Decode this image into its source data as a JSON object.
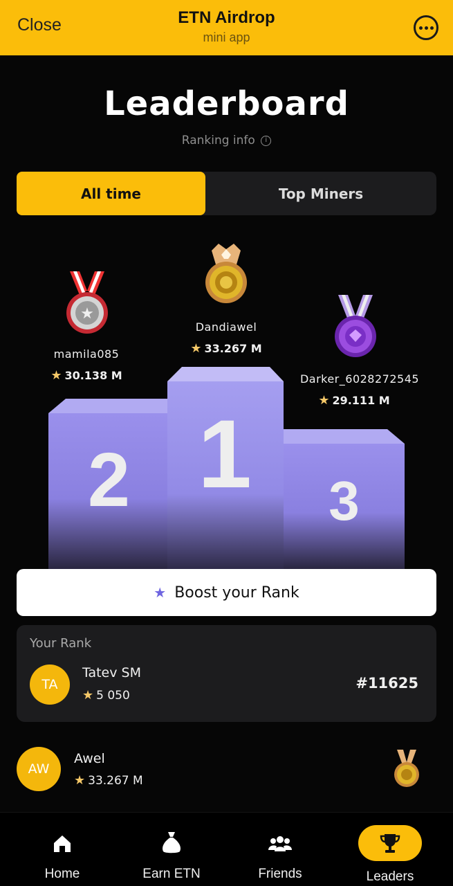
{
  "topbar": {
    "close_label": "Close",
    "title": "ETN Airdrop",
    "subtitle": "mini app",
    "more_icon": "more-horizontal-icon"
  },
  "page": {
    "title": "Leaderboard",
    "ranking_info": "Ranking info",
    "info_icon_glyph": "i"
  },
  "tabs": [
    {
      "label": "All time",
      "active": true
    },
    {
      "label": "Top Miners",
      "active": false
    }
  ],
  "podium": [
    {
      "place": "2",
      "name": "mamila085",
      "score": "30.138 M",
      "medal": "silver-medal-icon",
      "color": "#c9c9c9"
    },
    {
      "place": "1",
      "name": "Dandiawel",
      "score": "33.267 M",
      "medal": "gold-medal-icon",
      "color": "#d9a62a"
    },
    {
      "place": "3",
      "name": "Darker_6028272545",
      "score": "29.111 M",
      "medal": "purple-medal-icon",
      "color": "#8a3fd1"
    }
  ],
  "boost": {
    "label": "Boost your Rank"
  },
  "your_rank": {
    "label": "Your Rank",
    "initials": "TA",
    "name": "Tatev SM",
    "score": "5 050",
    "rank": "#11625"
  },
  "list": [
    {
      "initials": "AW",
      "name": "Awel",
      "score": "33.267 M",
      "medal": "gold-medal-icon"
    }
  ],
  "nav": [
    {
      "label": "Home",
      "icon": "home-icon",
      "active": false
    },
    {
      "label": "Earn ETN",
      "icon": "money-bag-icon",
      "active": false
    },
    {
      "label": "Friends",
      "icon": "friends-icon",
      "active": false
    },
    {
      "label": "Leaders",
      "icon": "trophy-icon",
      "active": true
    }
  ],
  "colors": {
    "accent": "#fbbd0a",
    "background": "#060606",
    "card": "#1c1c1e",
    "podium": "#8f86e6"
  }
}
